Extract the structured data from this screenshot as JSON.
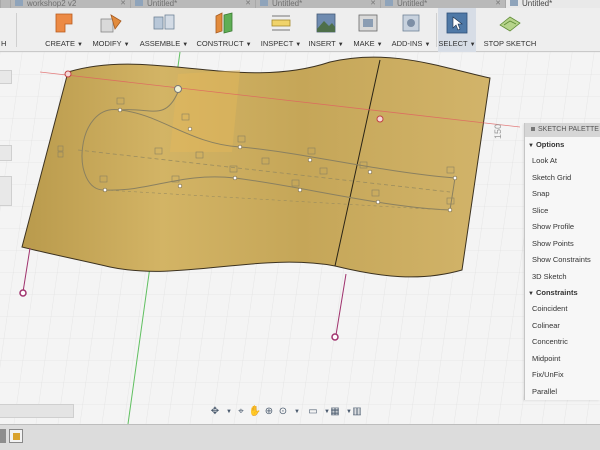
{
  "tabs": [
    {
      "label": "workshop2 v2",
      "active": false
    },
    {
      "label": "Untitled*",
      "active": false
    },
    {
      "label": "Untitled*",
      "active": false
    },
    {
      "label": "Untitled*",
      "active": false
    },
    {
      "label": "Untitled*",
      "active": true
    }
  ],
  "toolbar": {
    "sketch_partial": "H",
    "create": "CREATE",
    "modify": "MODIFY",
    "assemble": "ASSEMBLE",
    "construct": "CONSTRUCT",
    "inspect": "INSPECT",
    "insert": "INSERT",
    "make": "MAKE",
    "addins": "ADD-INS",
    "select": "SELECT",
    "stop_sketch": "STOP SKETCH"
  },
  "canvas": {
    "dimension_label": "150"
  },
  "sketch_palette": {
    "title": "SKETCH PALETTE",
    "options_header": "Options",
    "options": [
      "Look At",
      "Sketch Grid",
      "Snap",
      "Slice",
      "Show Profile",
      "Show Points",
      "Show Constraints",
      "3D Sketch"
    ],
    "constraints_header": "Constraints",
    "constraints": [
      "Coincident",
      "Colinear",
      "Concentric",
      "Midpoint",
      "Fix/UnFix",
      "Parallel"
    ]
  },
  "colors": {
    "surface": "#c9a95a",
    "selection": "#5b7fa6",
    "constraint_point": "#a0336e",
    "axis_green": "#60c060",
    "axis_red": "#e06060"
  }
}
